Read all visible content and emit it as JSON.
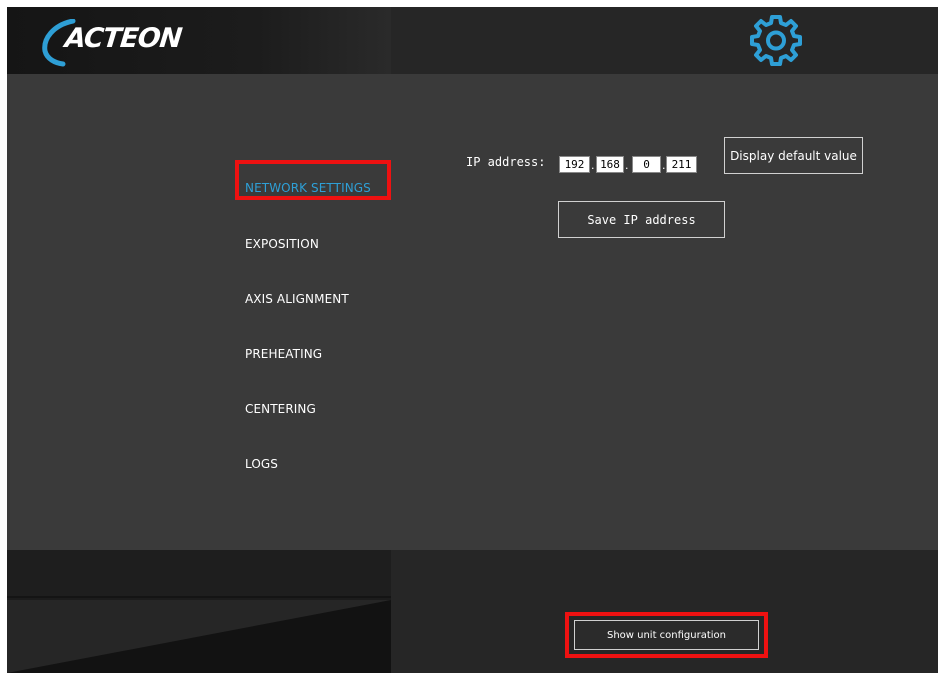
{
  "header": {
    "logo_text": "ACTEON",
    "settings_icon": "gear-icon"
  },
  "sidebar": {
    "items": [
      {
        "label": "NETWORK SETTINGS",
        "active": true
      },
      {
        "label": "EXPOSITION",
        "active": false
      },
      {
        "label": "AXIS ALIGNMENT",
        "active": false
      },
      {
        "label": "PREHEATING",
        "active": false
      },
      {
        "label": "CENTERING",
        "active": false
      },
      {
        "label": "LOGS",
        "active": false
      }
    ]
  },
  "network": {
    "ip_label": "IP address:",
    "ip_octets": [
      "192",
      "168",
      "0",
      "211"
    ],
    "display_default_label": "Display default value",
    "save_ip_label": "Save IP address"
  },
  "footer": {
    "show_unit_config_label": "Show unit configuration"
  },
  "colors": {
    "accent": "#2e9fd6",
    "highlight": "#ee1111",
    "background": "#3a3a3a"
  }
}
